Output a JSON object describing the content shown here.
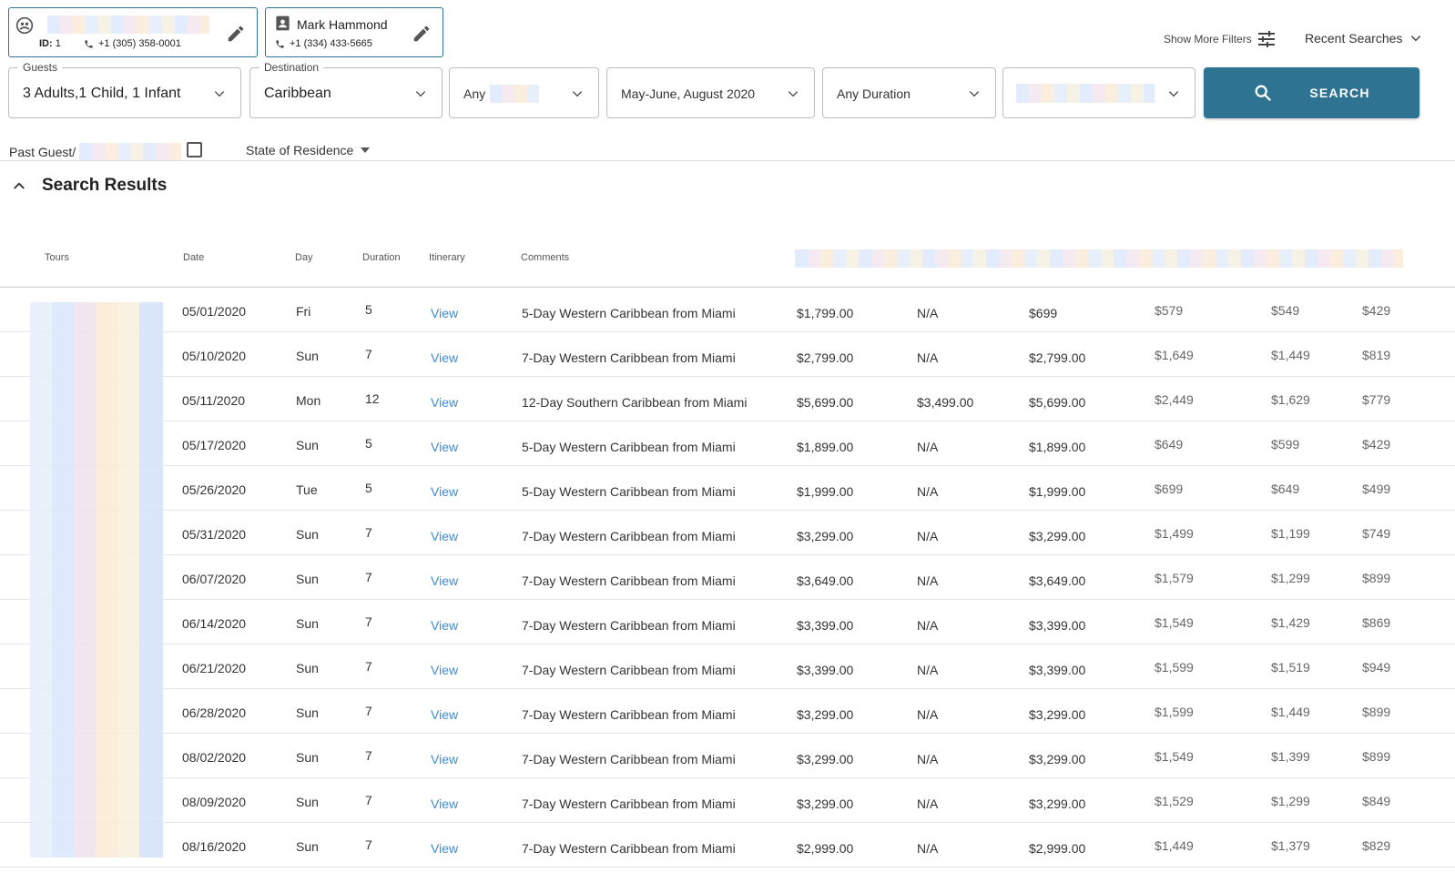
{
  "guest1": {
    "id_label": "ID:",
    "id_value": "1",
    "phone": "+1 (305) 358-0001"
  },
  "guest2": {
    "name": "Mark Hammond",
    "phone": "+1 (334) 433-5665"
  },
  "toolbar": {
    "show_more_filters": "Show More Filters",
    "recent_searches": "Recent Searches"
  },
  "filters": {
    "guests_label": "Guests",
    "guests_value": "3 Adults,1 Child, 1 Infant",
    "destination_label": "Destination",
    "destination_value": "Caribbean",
    "any_value": "Any",
    "dates_value": "May-June, August 2020",
    "duration_value": "Any Duration",
    "search_label": "SEARCH",
    "past_guest_label": "Past Guest/",
    "state_label": "State of Residence"
  },
  "results": {
    "title": "Search Results",
    "headers": {
      "tours": "Tours",
      "date": "Date",
      "day": "Day",
      "duration": "Duration",
      "itinerary": "Itinerary",
      "comments": "Comments"
    },
    "rows": [
      {
        "date": "05/01/2020",
        "day": "Fri",
        "duration": "5",
        "itinerary": "View",
        "comments": "5-Day Western Caribbean from Miami",
        "p1": "$1,799.00",
        "p2": "N/A",
        "p3": "$699",
        "p4": "$579",
        "p5": "$549",
        "p6": "$429"
      },
      {
        "date": "05/10/2020",
        "day": "Sun",
        "duration": "7",
        "itinerary": "View",
        "comments": "7-Day Western Caribbean from Miami",
        "p1": "$2,799.00",
        "p2": "N/A",
        "p3": "$2,799.00",
        "p4": "$1,649",
        "p5": "$1,449",
        "p6": "$819"
      },
      {
        "date": "05/11/2020",
        "day": "Mon",
        "duration": "12",
        "itinerary": "View",
        "comments": "12-Day Southern Caribbean from Miami",
        "p1": "$5,699.00",
        "p2": "$3,499.00",
        "p3": "$5,699.00",
        "p4": "$2,449",
        "p5": "$1,629",
        "p6": "$779"
      },
      {
        "date": "05/17/2020",
        "day": "Sun",
        "duration": "5",
        "itinerary": "View",
        "comments": "5-Day Western Caribbean from Miami",
        "p1": "$1,899.00",
        "p2": "N/A",
        "p3": "$1,899.00",
        "p4": "$649",
        "p5": "$599",
        "p6": "$429"
      },
      {
        "date": "05/26/2020",
        "day": "Tue",
        "duration": "5",
        "itinerary": "View",
        "comments": "5-Day Western Caribbean from Miami",
        "p1": "$1,999.00",
        "p2": "N/A",
        "p3": "$1,999.00",
        "p4": "$699",
        "p5": "$649",
        "p6": "$499"
      },
      {
        "date": "05/31/2020",
        "day": "Sun",
        "duration": "7",
        "itinerary": "View",
        "comments": "7-Day Western Caribbean from Miami",
        "p1": "$3,299.00",
        "p2": "N/A",
        "p3": "$3,299.00",
        "p4": "$1,499",
        "p5": "$1,199",
        "p6": "$749"
      },
      {
        "date": "06/07/2020",
        "day": "Sun",
        "duration": "7",
        "itinerary": "View",
        "comments": "7-Day Western Caribbean from Miami",
        "p1": "$3,649.00",
        "p2": "N/A",
        "p3": "$3,649.00",
        "p4": "$1,579",
        "p5": "$1,299",
        "p6": "$899"
      },
      {
        "date": "06/14/2020",
        "day": "Sun",
        "duration": "7",
        "itinerary": "View",
        "comments": "7-Day Western Caribbean from Miami",
        "p1": "$3,399.00",
        "p2": "N/A",
        "p3": "$3,399.00",
        "p4": "$1,549",
        "p5": "$1,429",
        "p6": "$869"
      },
      {
        "date": "06/21/2020",
        "day": "Sun",
        "duration": "7",
        "itinerary": "View",
        "comments": "7-Day Western Caribbean from Miami",
        "p1": "$3,399.00",
        "p2": "N/A",
        "p3": "$3,399.00",
        "p4": "$1,599",
        "p5": "$1,519",
        "p6": "$949"
      },
      {
        "date": "06/28/2020",
        "day": "Sun",
        "duration": "7",
        "itinerary": "View",
        "comments": "7-Day Western Caribbean from Miami",
        "p1": "$3,299.00",
        "p2": "N/A",
        "p3": "$3,299.00",
        "p4": "$1,599",
        "p5": "$1,449",
        "p6": "$899"
      },
      {
        "date": "08/02/2020",
        "day": "Sun",
        "duration": "7",
        "itinerary": "View",
        "comments": "7-Day Western Caribbean from Miami",
        "p1": "$3,299.00",
        "p2": "N/A",
        "p3": "$3,299.00",
        "p4": "$1,549",
        "p5": "$1,399",
        "p6": "$899"
      },
      {
        "date": "08/09/2020",
        "day": "Sun",
        "duration": "7",
        "itinerary": "View",
        "comments": "7-Day Western Caribbean from Miami",
        "p1": "$3,299.00",
        "p2": "N/A",
        "p3": "$3,299.00",
        "p4": "$1,529",
        "p5": "$1,299",
        "p6": "$849"
      },
      {
        "date": "08/16/2020",
        "day": "Sun",
        "duration": "7",
        "itinerary": "View",
        "comments": "7-Day Western Caribbean from Miami",
        "p1": "$2,999.00",
        "p2": "N/A",
        "p3": "$2,999.00",
        "p4": "$1,449",
        "p5": "$1,379",
        "p6": "$829"
      }
    ]
  },
  "colors": {
    "accent": "#2f7393",
    "link": "#3f8cd6"
  },
  "icons": [
    "guest-avatar-icon",
    "contact-card-icon",
    "phone-icon",
    "edit-pencil-icon",
    "tune-filters-icon",
    "chevron-down-icon",
    "search-icon",
    "dropdown-arrow-icon",
    "chevron-up-icon"
  ]
}
